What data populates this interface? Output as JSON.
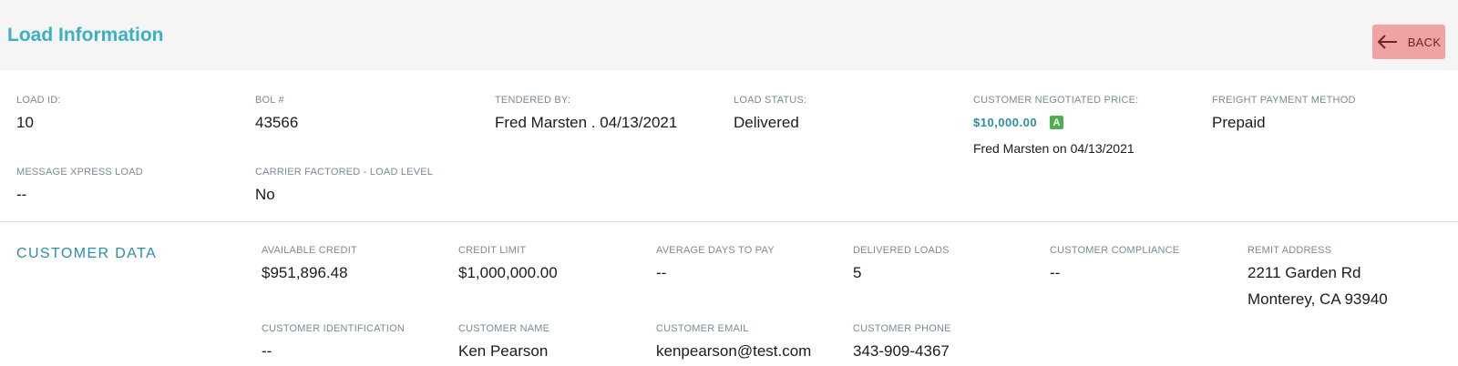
{
  "header": {
    "title": "Load Information",
    "back_label": "BACK"
  },
  "load": {
    "load_id": {
      "label": "LOAD ID:",
      "value": "10"
    },
    "bol": {
      "label": "BOL #",
      "value": "43566"
    },
    "tendered_by": {
      "label": "TENDERED BY:",
      "value": "Fred Marsten . 04/13/2021"
    },
    "status": {
      "label": "LOAD STATUS:",
      "value": "Delivered"
    },
    "price": {
      "label": "CUSTOMER NEGOTIATED PRICE:",
      "value": "$10,000.00",
      "badge": "A",
      "note": "Fred Marsten on 04/13/2021"
    },
    "payment_method": {
      "label": "FREIGHT PAYMENT METHOD",
      "value": "Prepaid"
    },
    "message_xpress": {
      "label": "MESSAGE XPRESS LOAD",
      "value": "--"
    },
    "carrier_factored": {
      "label": "CARRIER FACTORED - LOAD LEVEL",
      "value": "No"
    }
  },
  "customer": {
    "section_title": "CUSTOMER DATA",
    "available_credit": {
      "label": "AVAILABLE CREDIT",
      "value": "$951,896.48"
    },
    "credit_limit": {
      "label": "CREDIT LIMIT",
      "value": "$1,000,000.00"
    },
    "avg_days_to_pay": {
      "label": "AVERAGE DAYS TO PAY",
      "value": "--"
    },
    "delivered_loads": {
      "label": "DELIVERED LOADS",
      "value": "5"
    },
    "compliance": {
      "label": "CUSTOMER COMPLIANCE",
      "value": "--"
    },
    "remit_address": {
      "label": "REMIT ADDRESS",
      "line1": "2211 Garden Rd",
      "line2": "Monterey, CA 93940"
    },
    "identification": {
      "label": "CUSTOMER IDENTIFICATION",
      "value": "--"
    },
    "name": {
      "label": "CUSTOMER NAME",
      "value": "Ken Pearson"
    },
    "email": {
      "label": "CUSTOMER EMAIL",
      "value": "kenpearson@test.com"
    },
    "phone": {
      "label": "CUSTOMER PHONE",
      "value": "343-909-4367"
    }
  },
  "colors": {
    "title": "#3bb0c4",
    "accent": "#2a8fa3",
    "back_button": "#f0a3a3",
    "badge": "#4caf50"
  },
  "icons": {
    "back": "arrow-left-icon"
  }
}
